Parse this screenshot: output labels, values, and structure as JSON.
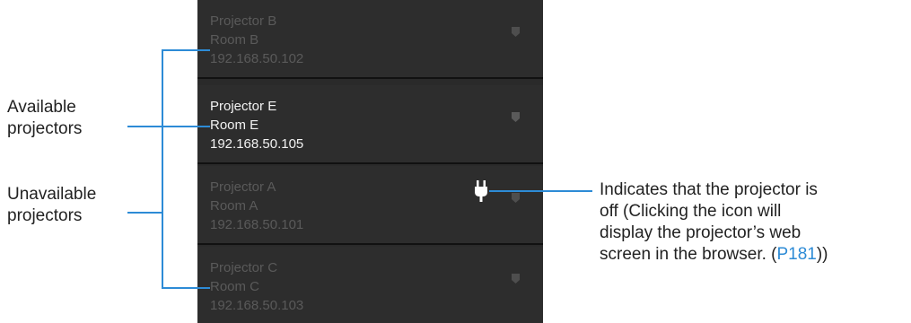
{
  "projectors": [
    {
      "name": "Projector B",
      "room": "Room B",
      "ip": "192.168.50.102",
      "state": "available"
    },
    {
      "name": "Projector E",
      "room": "Room E",
      "ip": "192.168.50.105",
      "state": "selected"
    },
    {
      "name": "Projector A",
      "room": "Room A",
      "ip": "192.168.50.101",
      "state": "off"
    },
    {
      "name": "Projector C",
      "room": "Room C",
      "ip": "192.168.50.103",
      "state": "unavailable"
    }
  ],
  "labels": {
    "available_line1": "Available",
    "available_line2": "projectors",
    "unavailable_line1": "Unavailable",
    "unavailable_line2": "projectors"
  },
  "callout": {
    "line1": "Indicates that the projector is",
    "line2": "off (Clicking the icon will",
    "line3": "display the projector’s web",
    "line4_prefix": "screen in the browser. (",
    "ref": "P181",
    "line4_suffix": "))"
  },
  "icons": {
    "status": "pentagon-status-icon",
    "power": "power-plug-icon"
  },
  "colors": {
    "accent": "#2d8bd6",
    "panel": "#2d2d2d"
  }
}
